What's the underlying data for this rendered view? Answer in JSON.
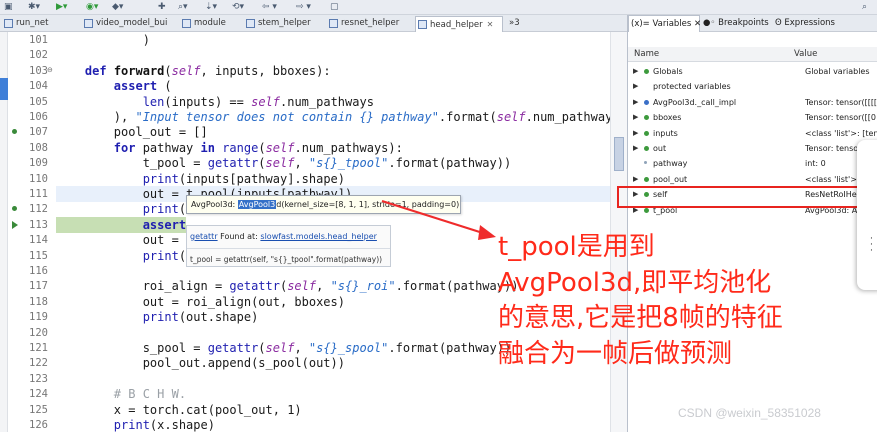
{
  "toolbar": {
    "buttons": [
      "bug-icon",
      "run-icon",
      "tools-icon",
      "search-icon",
      "nav-icon",
      "history-icon"
    ]
  },
  "editor_tabs": [
    {
      "label": "run_net",
      "active": false
    },
    {
      "label": "video_model_bui",
      "active": false
    },
    {
      "label": "module",
      "active": false
    },
    {
      "label": "stem_helper",
      "active": false
    },
    {
      "label": "resnet_helper",
      "active": false
    },
    {
      "label": "head_helper",
      "active": true,
      "close": "✕"
    },
    {
      "label": "»3",
      "active": false
    }
  ],
  "code": {
    "lines": [
      {
        "n": "101",
        "text": "            )"
      },
      {
        "n": "102",
        "text": ""
      },
      {
        "n": "103",
        "text": "    def forward(self, inputs, bboxes):"
      },
      {
        "n": "104",
        "text": "        assert ("
      },
      {
        "n": "105",
        "text": "            len(inputs) == self.num_pathways"
      },
      {
        "n": "106",
        "text": "        ), \"Input tensor does not contain {} pathway\".format(self.num_pathway"
      },
      {
        "n": "107",
        "text": "        pool_out = []"
      },
      {
        "n": "108",
        "text": "        for pathway in range(self.num_pathways):"
      },
      {
        "n": "109",
        "text": "            t_pool = getattr(self, \"s{}_tpool\".format(pathway))"
      },
      {
        "n": "110",
        "text": "            print(inputs[pathway].shape)"
      },
      {
        "n": "111",
        "text": "            out = t_pool(inputs[pathway])"
      },
      {
        "n": "112",
        "text": "            print(o"
      },
      {
        "n": "113",
        "text": "            assert"
      },
      {
        "n": "114",
        "text": "            out = t"
      },
      {
        "n": "115",
        "text": "            print(o"
      },
      {
        "n": "116",
        "text": ""
      },
      {
        "n": "117",
        "text": "            roi_align = getattr(self, \"s{}_roi\".format(pathway))"
      },
      {
        "n": "118",
        "text": "            out = roi_align(out, bboxes)"
      },
      {
        "n": "119",
        "text": "            print(out.shape)"
      },
      {
        "n": "120",
        "text": ""
      },
      {
        "n": "121",
        "text": "            s_pool = getattr(self, \"s{}_spool\".format(pathway))"
      },
      {
        "n": "122",
        "text": "            pool_out.append(s_pool(out))"
      },
      {
        "n": "123",
        "text": ""
      },
      {
        "n": "124",
        "text": "        # B C H W."
      },
      {
        "n": "125",
        "text": "        x = torch.cat(pool_out, 1)"
      },
      {
        "n": "126",
        "text": "        print(x.shape)"
      }
    ]
  },
  "popup": {
    "prefix": "AvgPool3d: ",
    "selected": "AvgPool3",
    "rest": "d(kernel_size=[8, 1, 1], stride=1, padding=0)"
  },
  "definition_popup": {
    "name": "getattr",
    "found": " Found at: ",
    "location": "slowfast.models.head_helper",
    "code": "t_pool = getattr(self, \"s{}_tpool\".format(pathway))"
  },
  "panel_tabs": [
    {
      "label": "(x)= Variables ✕",
      "active": true
    },
    {
      "label": "●◦ Breakpoints",
      "active": false
    },
    {
      "label": "ʘ Expressions",
      "active": false
    }
  ],
  "variables": {
    "col_name": "Name",
    "col_value": "Value",
    "rows": [
      {
        "name": "Globals",
        "value": "Global variables",
        "expand": "▶",
        "icon": "globe-icon"
      },
      {
        "name": "protected variables",
        "value": "",
        "expand": "▶",
        "icon": "folder-icon"
      },
      {
        "name": "AvgPool3d._call_impl",
        "value": "Tensor: tensor([[[[",
        "expand": "▶",
        "icon": "arrow-icon"
      },
      {
        "name": "bboxes",
        "value": "Tensor: tensor([[0",
        "expand": "▶",
        "icon": "var-icon"
      },
      {
        "name": "inputs",
        "value": "<class 'list'>: [tens",
        "expand": "▶",
        "icon": "var-icon"
      },
      {
        "name": "out",
        "value": "Tensor: tensor([[[[",
        "expand": "▶",
        "icon": "var-icon"
      },
      {
        "name": "pathway",
        "value": "int: 0",
        "expand": "",
        "icon": "var-icon"
      },
      {
        "name": "pool_out",
        "value": "<class 'list'>: []",
        "expand": "▶",
        "icon": "var-icon"
      },
      {
        "name": "self",
        "value": "ResNetRoIHead: R",
        "expand": "▶",
        "icon": "var-icon"
      },
      {
        "name": "t_pool",
        "value": "AvgPool3d: AvgPo",
        "expand": "▶",
        "icon": "var-icon"
      }
    ]
  },
  "annotation": {
    "lines": [
      "t_pool是用到",
      "AvgPool3d,即平均池化",
      "的意思,它是把8帧的特征",
      "融合为一帧后做预测"
    ]
  },
  "watermark": "CSDN @weixin_58351028",
  "colors": {
    "annotation": "#ff2a1a",
    "highlight_box": "#e8241f",
    "debug_line": "#c7dfb4"
  }
}
